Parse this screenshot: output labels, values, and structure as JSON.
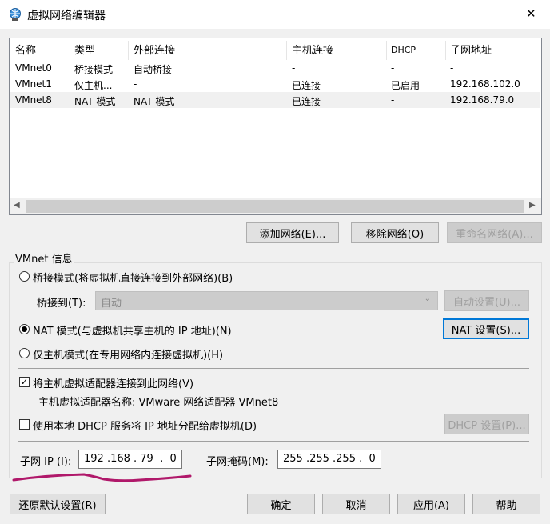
{
  "window": {
    "title": "虚拟网络编辑器",
    "close": "✕"
  },
  "table": {
    "headers": [
      "名称",
      "类型",
      "外部连接",
      "主机连接",
      "DHCP",
      "子网地址"
    ],
    "rows": [
      [
        "VMnet0",
        "桥接模式",
        "自动桥接",
        "-",
        "-",
        "-"
      ],
      [
        "VMnet1",
        "仅主机...",
        "-",
        "已连接",
        "已启用",
        "192.168.102.0"
      ],
      [
        "VMnet8",
        "NAT 模式",
        "NAT 模式",
        "已连接",
        "-",
        "192.168.79.0"
      ]
    ],
    "selected_row": 2,
    "scroll_left": "◀",
    "scroll_right": "▶"
  },
  "buttons": {
    "add": "添加网络(E)...",
    "remove": "移除网络(O)",
    "rename": "重命名网络(A)..."
  },
  "info": {
    "group_label": "VMnet 信息",
    "bridged": "桥接模式(将虚拟机直接连接到外部网络)(B)",
    "bridge_to_label": "桥接到(T):",
    "bridge_to_value": "自动",
    "auto_settings": "自动设置(U)...",
    "nat": "NAT 模式(与虚拟机共享主机的 IP 地址)(N)",
    "nat_settings": "NAT 设置(S)...",
    "host_only": "仅主机模式(在专用网络内连接虚拟机)(H)",
    "connect_adapter": "将主机虚拟适配器连接到此网络(V)",
    "adapter_name": "主机虚拟适配器名称: VMware 网络适配器 VMnet8",
    "dhcp": "使用本地 DHCP 服务将 IP 地址分配给虚拟机(D)",
    "dhcp_settings": "DHCP 设置(P)...",
    "subnet_ip_label": "子网 IP (I):",
    "subnet_ip": "192 .168 . 79  .  0",
    "mask_label": "子网掩码(M):",
    "mask": "255 .255 .255 .  0"
  },
  "footer": {
    "restore": "还原默认设置(R)",
    "ok": "确定",
    "cancel": "取消",
    "apply": "应用(A)",
    "help": "帮助"
  },
  "annotation_color": "#b0186a"
}
